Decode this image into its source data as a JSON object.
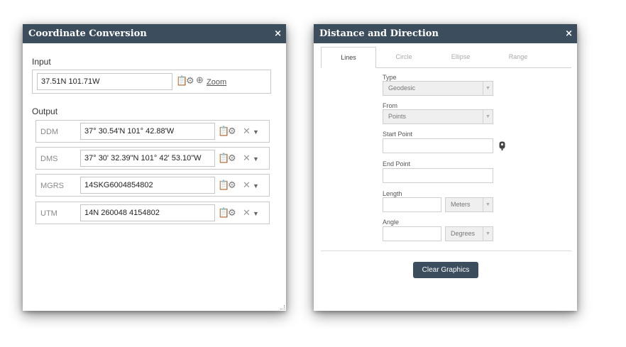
{
  "coordinate_conversion": {
    "title": "Coordinate Conversion",
    "close": "×",
    "input_label": "Input",
    "input_value": "37.51N 101.71W",
    "zoom_label": "Zoom",
    "output_label": "Output",
    "rows": [
      {
        "label": "DDM",
        "value": "37° 30.54'N 101° 42.88'W"
      },
      {
        "label": "DMS",
        "value": "37° 30' 32.39\"N 101° 42' 53.10\"W"
      },
      {
        "label": "MGRS",
        "value": "14SKG6004854802"
      },
      {
        "label": "UTM",
        "value": "14N 260048 4154802"
      }
    ],
    "icons": {
      "copy": "copy-icon",
      "settings": "gear-icon",
      "add": "plus-circle-icon",
      "remove": "close-icon",
      "expand": "chevron-down-icon"
    }
  },
  "distance_direction": {
    "title": "Distance and Direction",
    "close": "×",
    "tabs": [
      "Lines",
      "Circle",
      "Ellipse",
      "Range"
    ],
    "active_tab": "Lines",
    "type_label": "Type",
    "type_value": "Geodesic",
    "from_label": "From",
    "from_value": "Points",
    "start_point_label": "Start Point",
    "start_point_value": "",
    "end_point_label": "End Point",
    "end_point_value": "",
    "length_label": "Length",
    "length_unit": "Meters",
    "angle_label": "Angle",
    "angle_unit": "Degrees",
    "clear_button": "Clear Graphics"
  },
  "colors": {
    "header": "#3c4d5d",
    "button": "#3c4d5d"
  }
}
